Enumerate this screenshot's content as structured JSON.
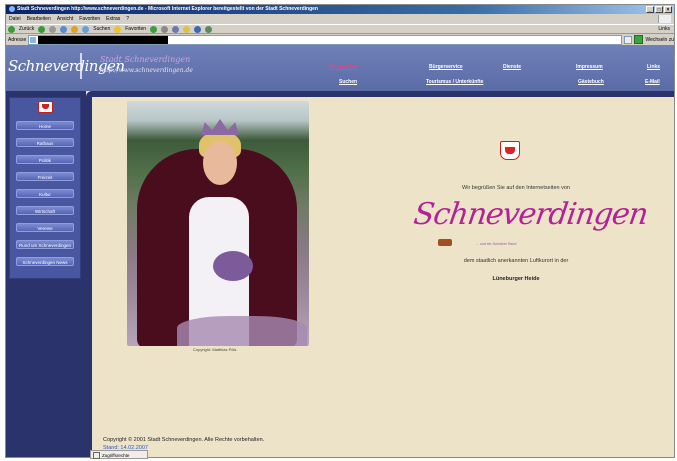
{
  "window": {
    "title": "Stadt Schneverdingen http://www.schneverdingen.de - Microsoft Internet Explorer bereitgestellt von der Stadt Schneverdingen",
    "controls": [
      "_",
      "□",
      "×"
    ]
  },
  "menubar": [
    "Datei",
    "Bearbeiten",
    "Ansicht",
    "Favoriten",
    "Extras",
    "?"
  ],
  "toolbar": {
    "back": "Zurück",
    "search": "Suchen",
    "favorites": "Favoriten",
    "links": "Links"
  },
  "addressbar": {
    "label": "Adresse",
    "go": "Wechseln zu"
  },
  "banner": {
    "logo": "Schneverdingen",
    "tag1": "Stadt Schneverdingen",
    "tag2": "http://www.schneverdingen.de"
  },
  "topnav": {
    "neuigkeiten": "Neuigkeiten",
    "suchen": "Suchen",
    "buergerservice": "Bürgerservice",
    "tourismus": "Tourismus / Unterkünfte",
    "dienste": "Dienste",
    "impressum": "Impressum",
    "gaestebuch": "Gästebuch",
    "links": "Links",
    "email": "E-Mail"
  },
  "sidebar": {
    "items": [
      "Home",
      "Rathaus",
      "Politik",
      "Freizeit",
      "Kultur",
      "Wirtschaft",
      "Vereine",
      "Rund um Schneverdingen",
      "Schneverdingen News"
    ]
  },
  "photo": {
    "caption": "Copyright: Matthias Pöls"
  },
  "welcome": {
    "line1": "Wir begrüßen Sie auf den Internetseiten von",
    "signature": "Schneverdingen",
    "signature_sub": "... und ein Schnitzer Rand",
    "line2": "dem staatlich anerkannten Luftkurort in der",
    "line3": "Lüneburger Heide"
  },
  "footer": {
    "copyright": "Copyright © 2001 Stadt Schneverdingen. Alle Rechte vorbehalten.",
    "stand": "Stand: 14.02.2007"
  },
  "statusbar": {
    "label": "Zugriffsrechte"
  },
  "colors": {
    "banner": "#6f80b8",
    "sidebar_frame": "#2b336c",
    "sidebar_button": "#6a79c4",
    "content_bg": "#ede3c8",
    "signature": "#b32196",
    "active_nav": "#ff3a7a"
  }
}
